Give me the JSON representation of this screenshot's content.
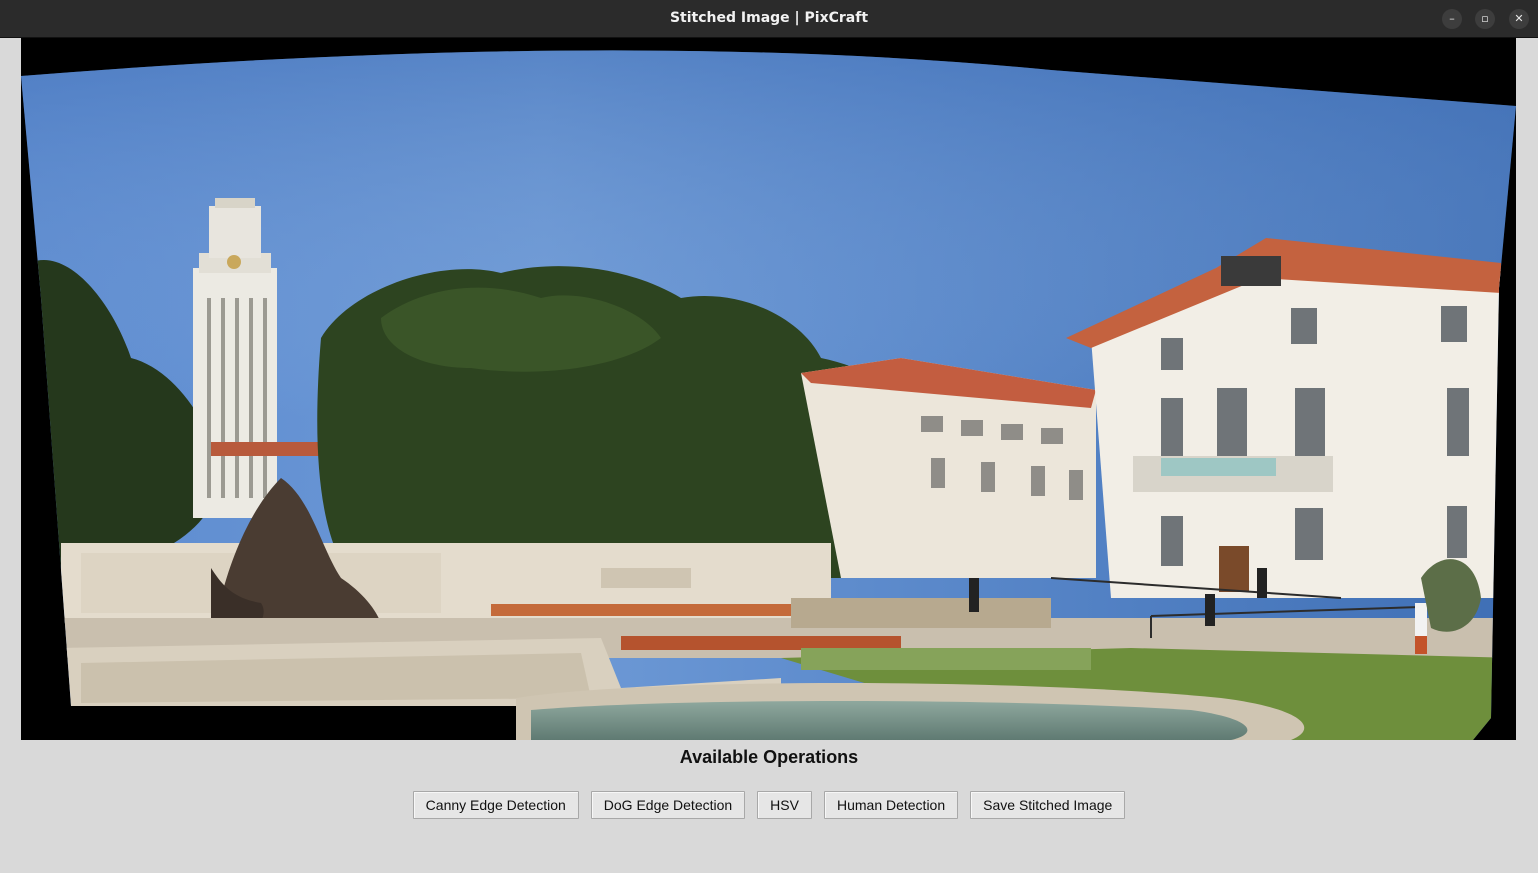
{
  "window": {
    "title": "Stitched Image | PixCraft",
    "controls": {
      "minimize": "–",
      "maximize": "▫",
      "close": "✕"
    }
  },
  "image": {
    "description_icon": "stitched-panorama"
  },
  "operations": {
    "heading": "Available Operations",
    "buttons": [
      {
        "label": "Canny Edge Detection"
      },
      {
        "label": "DoG Edge Detection"
      },
      {
        "label": "HSV"
      },
      {
        "label": "Human Detection"
      },
      {
        "label": "Save Stitched Image"
      }
    ]
  },
  "colors": {
    "background": "#d9d9d9",
    "titlebar": "#2b2b2b",
    "sky": "#4f7fc0"
  }
}
